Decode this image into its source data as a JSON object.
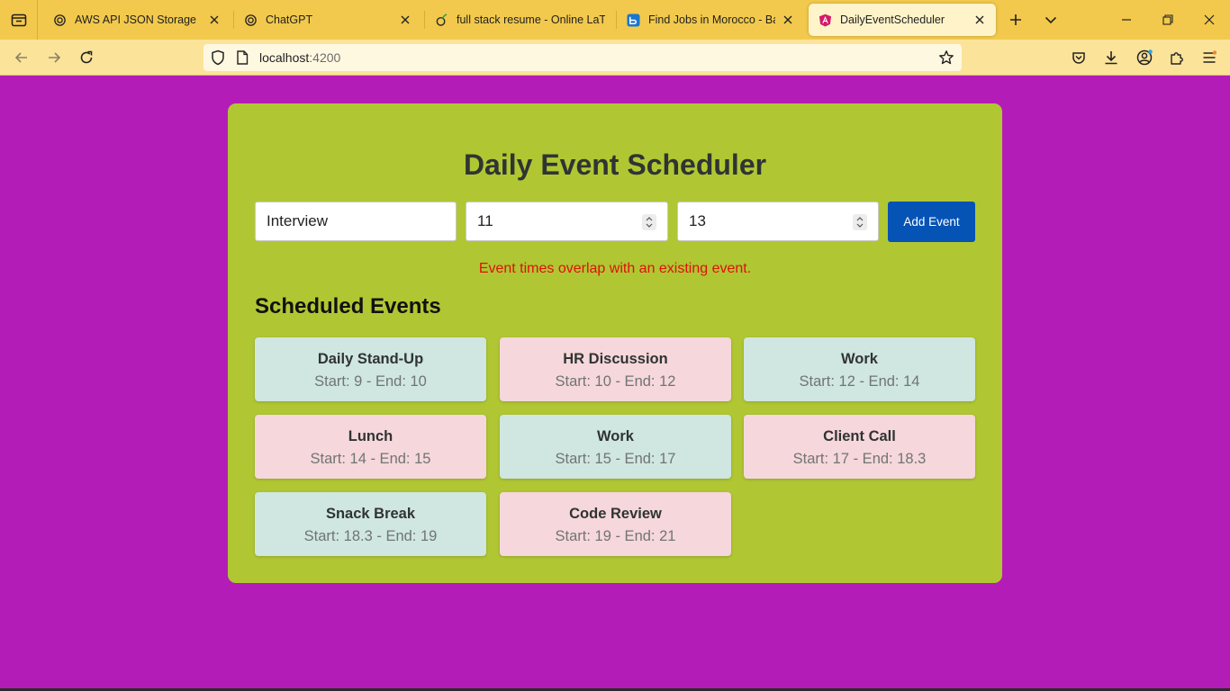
{
  "browser": {
    "tabs": [
      {
        "title": "AWS API JSON Storage",
        "icon": "openai-icon"
      },
      {
        "title": "ChatGPT",
        "icon": "openai-icon"
      },
      {
        "title": "full stack resume - Online LaTeX",
        "icon": "overleaf-icon"
      },
      {
        "title": "Find Jobs in Morocco - Bayt.com",
        "icon": "bayt-icon"
      },
      {
        "title": "DailyEventScheduler",
        "icon": "angular-icon"
      }
    ],
    "url_host": "localhost",
    "url_port": ":4200"
  },
  "app": {
    "title": "Daily Event Scheduler",
    "form": {
      "name_value": "Interview",
      "start_value": "11",
      "end_value": "13",
      "add_label": "Add Event"
    },
    "error_message": "Event times overlap with an existing event.",
    "section_title": "Scheduled Events",
    "events": [
      {
        "name": "Daily Stand-Up",
        "time": "Start: 9 - End: 10"
      },
      {
        "name": "HR Discussion",
        "time": "Start: 10 - End: 12"
      },
      {
        "name": "Work",
        "time": "Start: 12 - End: 14"
      },
      {
        "name": "Lunch",
        "time": "Start: 14 - End: 15"
      },
      {
        "name": "Work",
        "time": "Start: 15 - End: 17"
      },
      {
        "name": "Client Call",
        "time": "Start: 17 - End: 18.3"
      },
      {
        "name": "Snack Break",
        "time": "Start: 18.3 - End: 19"
      },
      {
        "name": "Code Review",
        "time": "Start: 19 - End: 21"
      }
    ]
  },
  "colors": {
    "page_background": "#b41cb8",
    "card_background": "#b0c733",
    "button": "#0653b6",
    "error": "#e0100c",
    "event_green": "#d0e6e1",
    "event_pink": "#f6d7db"
  }
}
